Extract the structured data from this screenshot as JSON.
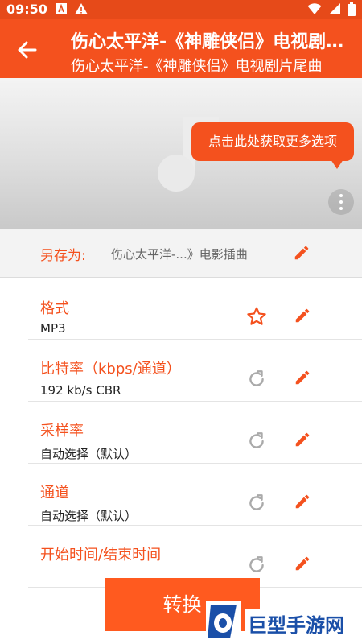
{
  "status_bar": {
    "time": "09:50",
    "left_icons": [
      "text-a-icon",
      "warning-icon"
    ],
    "right_icons": [
      "wifi-icon",
      "signal-icon",
      "battery-icon"
    ]
  },
  "appbar": {
    "title": "伤心太平洋-《神雕侠侣》电视剧片尾曲",
    "subtitle": "伤心太平洋-《神雕侠侣》电视剧片尾曲"
  },
  "hero": {
    "tooltip": "点击此处获取更多选项"
  },
  "save_as": {
    "label": "另存为:",
    "value": "伤心太平洋-...》电影插曲"
  },
  "settings": [
    {
      "title": "格式",
      "value": "MP3",
      "action_icon": "star-outline-icon"
    },
    {
      "title": "比特率（kbps/通道）",
      "value": "192 kb/s CBR",
      "action_icon": "reset-icon"
    },
    {
      "title": "采样率",
      "value": "自动选择（默认）",
      "action_icon": "reset-icon"
    },
    {
      "title": "通道",
      "value": "自动选择（默认）",
      "action_icon": "reset-icon"
    },
    {
      "title": "开始时间/结束时间",
      "value": "",
      "action_icon": "reset-icon"
    }
  ],
  "convert_button": "转换",
  "watermark": {
    "text": "巨型手游网"
  },
  "colors": {
    "accent": "#f4511e",
    "status_bar": "#e64a19",
    "watermark_blue": "#1a4fa8"
  }
}
